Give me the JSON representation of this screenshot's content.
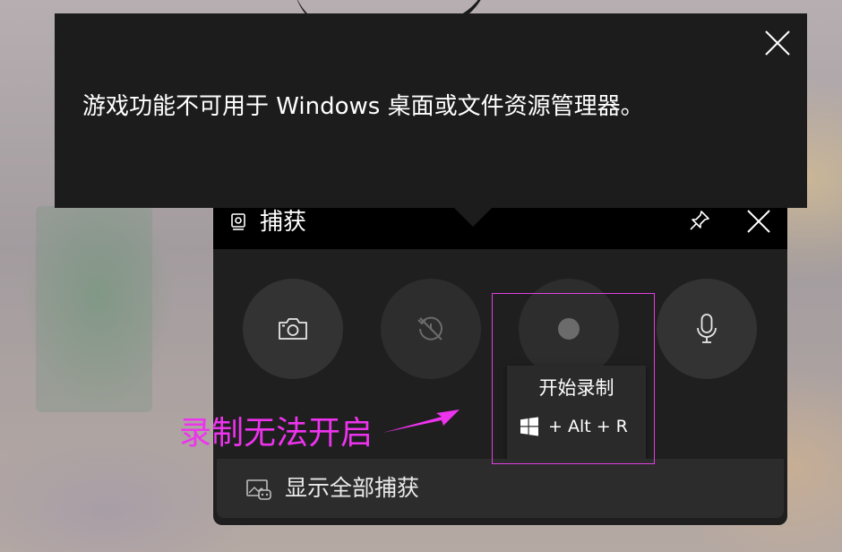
{
  "notification": {
    "message": "游戏功能不可用于 Windows 桌面或文件资源管理器。",
    "close_icon": "close-icon"
  },
  "capture_widget": {
    "title": "捕获",
    "title_icon": "webcam-icon",
    "header_buttons": [
      {
        "name": "pin",
        "icon": "pin-icon"
      },
      {
        "name": "close",
        "icon": "close-icon"
      }
    ],
    "buttons": [
      {
        "name": "screenshot",
        "icon": "camera-icon",
        "enabled": true
      },
      {
        "name": "record-last-30s",
        "icon": "replay-disabled-icon",
        "enabled": false
      },
      {
        "name": "start-recording",
        "icon": "record-dot-icon",
        "enabled": false
      },
      {
        "name": "microphone",
        "icon": "microphone-icon",
        "enabled": true
      }
    ],
    "tooltip": {
      "label": "开始录制",
      "shortcut_icon": "windows-logo-icon",
      "shortcut": "+ Alt + R"
    },
    "footer": {
      "label": "显示全部捕获",
      "icon": "gallery-icon"
    }
  },
  "annotation": {
    "text": "录制无法开启",
    "color": "#ee33ee"
  }
}
